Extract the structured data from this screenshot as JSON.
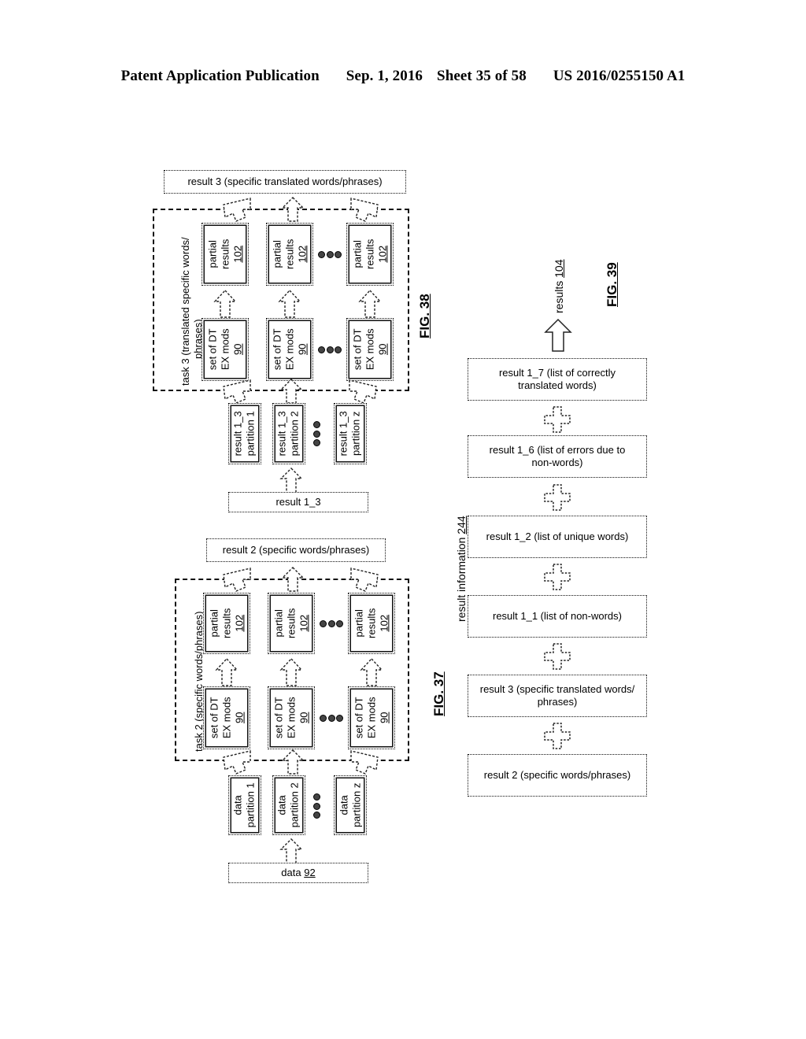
{
  "header": {
    "publication": "Patent Application Publication",
    "date": "Sep. 1, 2016",
    "sheet": "Sheet 35 of 58",
    "number": "US 2016/0255150 A1"
  },
  "fig38": {
    "fig_label": "FIG. 38",
    "top_box": "result  3 (specific translated words/phrases)",
    "group_label_line1": "task 3 (translated specific words/",
    "group_label_line2": "phrases)",
    "partial_results_boxes": [
      {
        "line1": "partial",
        "line2": "results",
        "ref": "102"
      },
      {
        "line1": "partial",
        "line2": "results",
        "ref": "102"
      },
      {
        "line1": "partial",
        "line2": "results",
        "ref": "102"
      }
    ],
    "module_boxes": [
      {
        "line1": "set of DT",
        "line2": "EX mods",
        "ref": "90"
      },
      {
        "line1": "set of DT",
        "line2": "EX mods",
        "ref": "90"
      },
      {
        "line1": "set of DT",
        "line2": "EX mods",
        "ref": "90"
      }
    ],
    "partition_boxes": [
      {
        "line1": "result 1_3",
        "line2": "partition 1"
      },
      {
        "line1": "result 1_3",
        "line2": "partition 2"
      },
      {
        "line1": "result 1_3",
        "line2": "partition z"
      }
    ],
    "source_box": "result 1_3"
  },
  "fig37": {
    "fig_label": "FIG. 37",
    "top_box": "result  2 (specific words/phrases)",
    "group_label": "task 2 (specific words/phrases)",
    "partial_results_boxes": [
      {
        "line1": "partial",
        "line2": "results",
        "ref": "102"
      },
      {
        "line1": "partial",
        "line2": "results",
        "ref": "102"
      },
      {
        "line1": "partial",
        "line2": "results",
        "ref": "102"
      }
    ],
    "module_boxes": [
      {
        "line1": "set of DT",
        "line2": "EX mods",
        "ref": "90"
      },
      {
        "line1": "set of DT",
        "line2": "EX mods",
        "ref": "90"
      },
      {
        "line1": "set of DT",
        "line2": "EX mods",
        "ref": "90"
      }
    ],
    "partition_boxes": [
      {
        "line1": "data",
        "line2": "partition 1"
      },
      {
        "line1": "data",
        "line2": "partition 2"
      },
      {
        "line1": "data",
        "line2": "partition z"
      }
    ],
    "source_box_text": "data ",
    "source_box_ref": "92"
  },
  "fig39": {
    "fig_label": "FIG. 39",
    "output_label_text": "results ",
    "output_label_ref": "104",
    "bracket_label_text": "result information ",
    "bracket_label_ref": "244",
    "boxes": [
      "result 1_7 (list of correctly translated words)",
      "result 1_6 (list of errors due to non-words)",
      "result 1_2 (list of unique words)",
      "result 1_1 (list of non-words)",
      "result  3 (specific translated words/ phrases)",
      "result  2 (specific words/phrases)"
    ],
    "boxes_lines": [
      [
        "result 1_7 (list of correctly",
        "translated words)"
      ],
      [
        "result 1_6 (list of errors due to",
        "non-words)"
      ],
      [
        "result 1_2 (list of unique words)"
      ],
      [
        "result 1_1 (list of non-words)"
      ],
      [
        "result  3 (specific translated words/",
        "phrases)"
      ],
      [
        "result  2 (specific words/phrases)"
      ]
    ],
    "connector": "plus"
  }
}
